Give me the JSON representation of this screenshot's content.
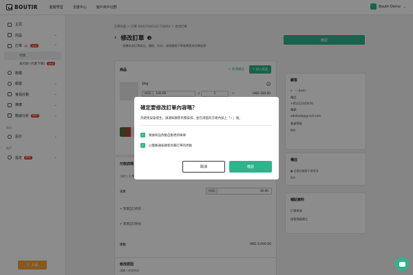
{
  "topbar": {
    "logo": "BOUTIR",
    "links": [
      "客服學堂",
      "支援中心",
      "客戶商戶社群"
    ],
    "shop_name": "Boutir Demo"
  },
  "sidebar": {
    "items": [
      {
        "label": "主頁"
      },
      {
        "label": "商品"
      },
      {
        "label": "訂單",
        "count": "2",
        "badge": "NEW"
      },
      {
        "label": "付款"
      },
      {
        "label": "未付款 (代客下單)",
        "badge": "NEW"
      },
      {
        "label": "數碼"
      },
      {
        "label": "顧客"
      },
      {
        "label": "會員計劃"
      },
      {
        "label": "推廣"
      },
      {
        "label": "數據分析",
        "badge": "NEW"
      }
    ],
    "section_shop": "商店",
    "design": "設計",
    "section_account": "帳戶",
    "settings": "設定",
    "settings_badge": "NEW",
    "upgrade": "升級"
  },
  "main": {
    "breadcrumb": "訂單列表 ＞ 訂單 #0627020121770640 ＞ 修改訂單",
    "title": "修改訂單",
    "subtitle": "連續修改訂單商品、價格、折扣。處理顧客下單後需要與這筆變更",
    "confirm_top": "確認",
    "products": {
      "header": "商品",
      "edit_link": "+ 新增備註",
      "add_button": "+ 加入商品",
      "item_name": "1kg",
      "currency": "HKD",
      "price": "100.00",
      "qty": "1",
      "line_total": "HKD 100.00"
    },
    "payment": {
      "header": "付款詳情",
      "subtotal": "小計 ( 1 件商品 )",
      "shipping_label": "運費",
      "currency": "HKD",
      "shipping_value": "30.00",
      "add_discount": "+ 新增自訂折扣",
      "add_fee": "+ 新增自訂附加",
      "total_label": "總數",
      "total_value": "HKD 2,000.00"
    },
    "reason": {
      "header": "修改原因",
      "sub": "請輸入修改原因"
    },
    "customer": {
      "header": "顧客",
      "name": "s　－ basic",
      "phone_label": "電話",
      "phone": "+85212345678",
      "email_label": "電郵",
      "email": "adadada@gmail.com",
      "member_label": "會員等級",
      "member": "N/A"
    },
    "note": {
      "header": "備註",
      "hint": "此備註顧客不會看見",
      "value": "N/A"
    },
    "extra": {
      "header": "補貼資料",
      "source_label": "訂單來源",
      "source": "由管理員建立"
    }
  },
  "modal": {
    "title": "確定要修改訂單內容嗎？",
    "desc": "為避免誤會發生，請通知顧客有關安排，並在適當的方格內加上「✓」號。",
    "check1": "根據商品改動自動更新庫庫",
    "check2": "以電郵通知顧客有關訂單的改動",
    "cancel": "取消",
    "confirm": "確認"
  }
}
